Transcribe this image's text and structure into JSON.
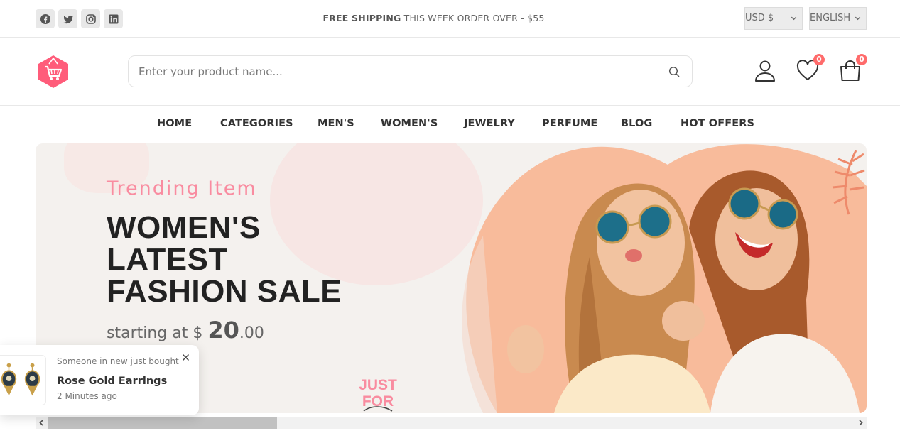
{
  "topbar": {
    "social_icons": [
      "facebook-icon",
      "twitter-icon",
      "instagram-icon",
      "linkedin-icon"
    ],
    "promo_bold": "FREE SHIPPING",
    "promo_rest": " THIS WEEK ORDER OVER - $55",
    "currency": "USD $",
    "language": "ENGLISH"
  },
  "header": {
    "search_placeholder": "Enter your product name...",
    "wishlist_count": "0",
    "cart_count": "0"
  },
  "nav": {
    "items": [
      "HOME",
      "CATEGORIES",
      "MEN'S",
      "WOMEN'S",
      "JEWELRY",
      "PERFUME",
      "BLOG",
      "HOT OFFERS"
    ]
  },
  "banner": {
    "subtitle": "Trending Item",
    "headline_line1": "WOMEN'S",
    "headline_line2": "LATEST",
    "headline_line3": "FASHION SALE",
    "price_prefix": "starting at $ ",
    "price_int": "20",
    "price_dec": ".00",
    "side_text_line1": "JUST",
    "side_text_line2": "FOR"
  },
  "toast": {
    "meta": "Someone in new just bought",
    "product": "Rose Gold Earrings",
    "time": "2 Minutes ago"
  },
  "colors": {
    "accent": "#ff8f9c",
    "badge": "#ff6b6b",
    "logo": "#ff5c7a"
  }
}
